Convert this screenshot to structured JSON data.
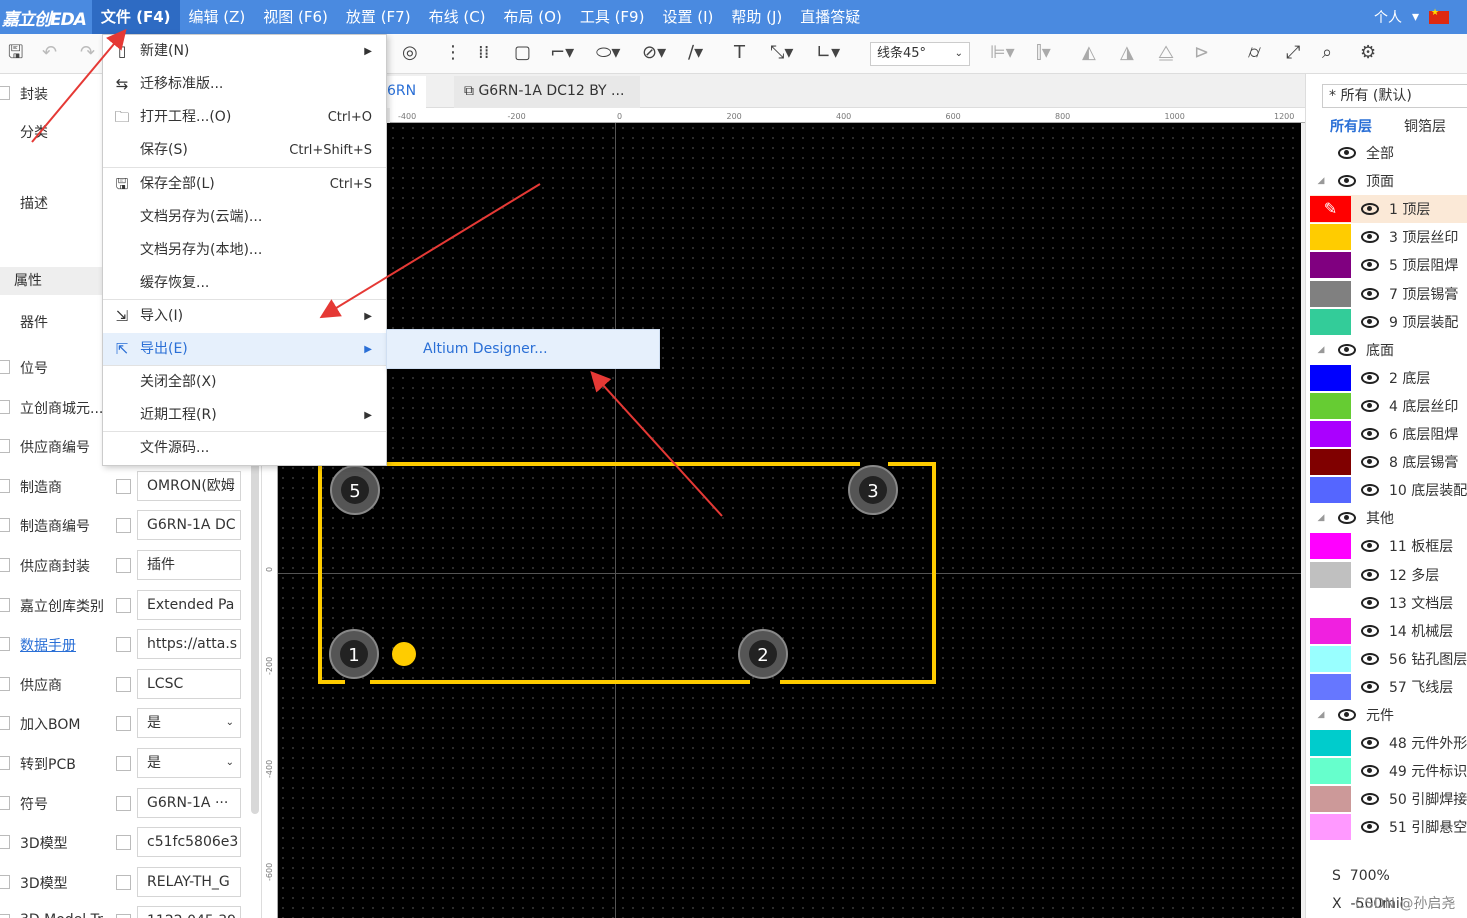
{
  "app": {
    "logo": "嘉立创EDA"
  },
  "menubar": {
    "items": [
      "文件 (F4)",
      "编辑 (Z)",
      "视图 (F6)",
      "放置 (F7)",
      "布线 (C)",
      "布局 (O)",
      "工具 (F9)",
      "设置 (I)",
      "帮助 (J)",
      "直播答疑"
    ],
    "active_index": 0,
    "user": "个人",
    "user_caret": "▾"
  },
  "toolbar": {
    "line_mode": "线条45°",
    "icons": [
      "save-icon",
      "undo-icon",
      "redo-icon",
      "via-icon",
      "dots-icon",
      "grid-dots-icon",
      "rect-icon",
      "polyline-icon",
      "ellipse-icon",
      "no-entry-icon",
      "line-icon",
      "text-icon",
      "dimension-icon",
      "angle-icon",
      "align-icon",
      "distribute-icon",
      "flip-icon",
      "mirror-icon",
      "mirror2-icon",
      "shape-icon",
      "ruler-icon",
      "measure-icon",
      "pcb-check-icon",
      "settings-icon"
    ]
  },
  "file_menu": {
    "items": [
      {
        "label": "新建(N)",
        "shortcut": "",
        "submenu": true,
        "icon": "new-file-icon"
      },
      {
        "label": "迁移标准版...",
        "shortcut": "",
        "submenu": false,
        "icon": "migrate-icon"
      },
      {
        "label": "打开工程...(O)",
        "shortcut": "Ctrl+O",
        "submenu": false,
        "icon": "folder-icon"
      },
      {
        "label": "保存(S)",
        "shortcut": "Ctrl+Shift+S",
        "submenu": false,
        "icon": ""
      },
      {
        "label": "保存全部(L)",
        "shortcut": "Ctrl+S",
        "submenu": false,
        "icon": "save-all-icon"
      },
      {
        "label": "文档另存为(云端)...",
        "shortcut": "",
        "submenu": false,
        "icon": ""
      },
      {
        "label": "文档另存为(本地)...",
        "shortcut": "",
        "submenu": false,
        "icon": ""
      },
      {
        "label": "缓存恢复...",
        "shortcut": "",
        "submenu": false,
        "icon": ""
      },
      {
        "label": "导入(I)",
        "shortcut": "",
        "submenu": true,
        "icon": "import-icon"
      },
      {
        "label": "导出(E)",
        "shortcut": "",
        "submenu": true,
        "icon": "export-icon"
      },
      {
        "label": "关闭全部(X)",
        "shortcut": "",
        "submenu": false,
        "icon": ""
      },
      {
        "label": "近期工程(R)",
        "shortcut": "",
        "submenu": true,
        "icon": ""
      },
      {
        "label": "文件源码...",
        "shortcut": "",
        "submenu": false,
        "icon": ""
      }
    ],
    "highlighted_index": 9,
    "export_submenu": [
      "Altium Designer..."
    ]
  },
  "tabs": [
    {
      "label": "6RN"
    },
    {
      "label": "G6RN-1A DC12 BY ..."
    }
  ],
  "rulers": {
    "h_ticks": [
      "-400",
      "-200",
      "0",
      "200",
      "400",
      "600",
      "800",
      "1000",
      "1200"
    ],
    "v_ticks": [
      "0",
      "-200",
      "-400",
      "-600"
    ]
  },
  "left_panel": {
    "top_labels": [
      "封装",
      "分类",
      "描述"
    ],
    "section": "属性",
    "device_label": "器件",
    "rows": [
      {
        "label": "位号",
        "value": ""
      },
      {
        "label": "立创商城元...",
        "value": ""
      },
      {
        "label": "供应商编号",
        "value": ""
      },
      {
        "label": "制造商",
        "value": "OMRON(欧姆"
      },
      {
        "label": "制造商编号",
        "value": "G6RN-1A DC"
      },
      {
        "label": "供应商封装",
        "value": "插件"
      },
      {
        "label": "嘉立创库类别",
        "value": "Extended Pa"
      },
      {
        "label": "数据手册",
        "value": "https://atta.s"
      },
      {
        "label": "供应商",
        "value": "LCSC"
      },
      {
        "label": "加入BOM",
        "value": "是"
      },
      {
        "label": "转到PCB",
        "value": "是"
      },
      {
        "label": "符号",
        "value": "G6RN-1A ···"
      },
      {
        "label": "3D模型",
        "value": "c51fc5806e3"
      },
      {
        "label": "3D模型",
        "value": "RELAY-TH_G"
      },
      {
        "label": "3D Model Tr",
        "value": "1122.045 39"
      }
    ]
  },
  "pads": [
    "5",
    "3",
    "1",
    "2"
  ],
  "right_panel": {
    "filter": "* 所有 (默认)",
    "tabs": [
      "所有层",
      "铜箔层"
    ],
    "layers": [
      {
        "name": "全部",
        "group": true,
        "color": ""
      },
      {
        "name": "顶面",
        "group": true,
        "color": ""
      },
      {
        "name": "1 顶层",
        "group": false,
        "color": "#ff0000",
        "active": true
      },
      {
        "name": "3 顶层丝印",
        "group": false,
        "color": "#ffcc00"
      },
      {
        "name": "5 顶层阻焊",
        "group": false,
        "color": "#800080"
      },
      {
        "name": "7 顶层锡膏",
        "group": false,
        "color": "#808080"
      },
      {
        "name": "9 顶层装配",
        "group": false,
        "color": "#33cc99"
      },
      {
        "name": "底面",
        "group": true,
        "color": ""
      },
      {
        "name": "2 底层",
        "group": false,
        "color": "#0000ff"
      },
      {
        "name": "4 底层丝印",
        "group": false,
        "color": "#66cc33"
      },
      {
        "name": "6 底层阻焊",
        "group": false,
        "color": "#aa00ff"
      },
      {
        "name": "8 底层锡膏",
        "group": false,
        "color": "#800000"
      },
      {
        "name": "10 底层装配",
        "group": false,
        "color": "#5566ff"
      },
      {
        "name": "其他",
        "group": true,
        "color": ""
      },
      {
        "name": "11 板框层",
        "group": false,
        "color": "#ff00ff"
      },
      {
        "name": "12 多层",
        "group": false,
        "color": "#c0c0c0"
      },
      {
        "name": "13 文档层",
        "group": false,
        "color": "#ffffff"
      },
      {
        "name": "14 机械层",
        "group": false,
        "color": "#f020e0"
      },
      {
        "name": "56 钻孔图层",
        "group": false,
        "color": "#99ffff"
      },
      {
        "name": "57 飞线层",
        "group": false,
        "color": "#6677ff"
      },
      {
        "name": "元件",
        "group": true,
        "color": ""
      },
      {
        "name": "48 元件外形",
        "group": false,
        "color": "#00cccc"
      },
      {
        "name": "49 元件标识",
        "group": false,
        "color": "#66ffcc"
      },
      {
        "name": "50 引脚焊接",
        "group": false,
        "color": "#cc9999"
      },
      {
        "name": "51 引脚悬空",
        "group": false,
        "color": "#ff99ff"
      }
    ],
    "footer": [
      {
        "key": "S",
        "value": "700%"
      },
      {
        "key": "X",
        "value": "-500mil"
      }
    ]
  },
  "watermark": "CSDN @孙启尧",
  "colors": {
    "menubar": "#4a8ae0",
    "outline": "#ffcc00",
    "accent": "#2a6fd6",
    "arrow": "#e53935"
  }
}
